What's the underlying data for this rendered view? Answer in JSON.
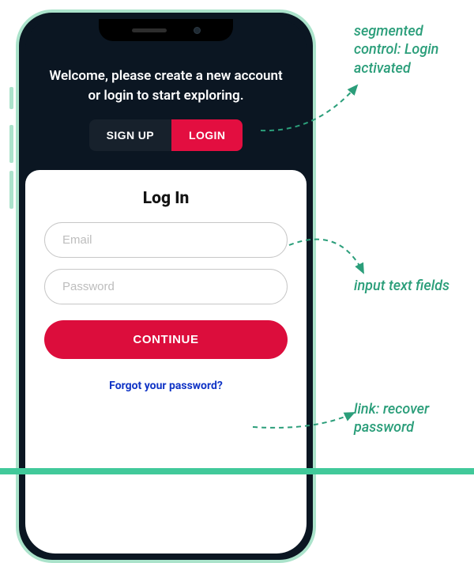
{
  "header": {
    "welcome": "Welcome, please create a new account or login to start exploring."
  },
  "segmented": {
    "signup_label": "SIGN UP",
    "login_label": "LOGIN"
  },
  "card": {
    "title": "Log In",
    "email_placeholder": "Email",
    "password_placeholder": "Password",
    "continue_label": "CONTINUE",
    "forgot_label": "Forgot your password?"
  },
  "annotations": {
    "segmented": "segmented control: Login activated",
    "inputs": "input text fields",
    "forgot": "link: recover password"
  }
}
